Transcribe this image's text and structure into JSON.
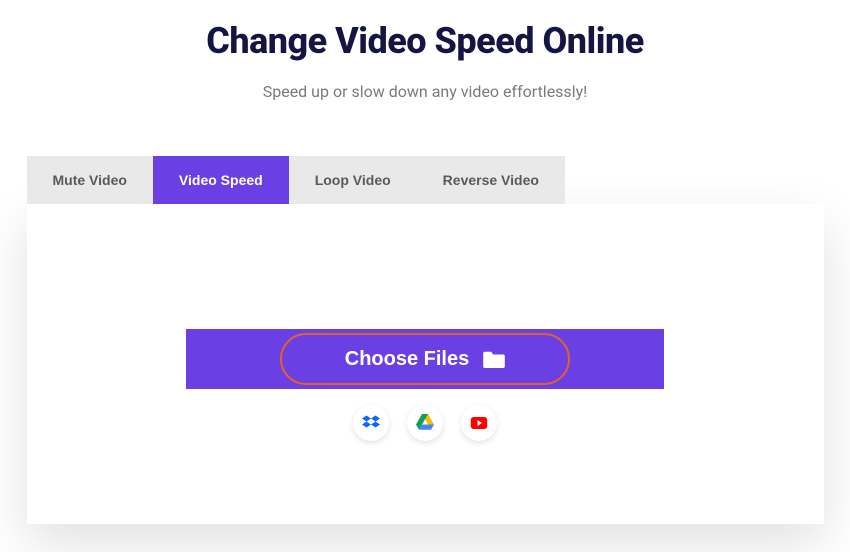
{
  "header": {
    "title": "Change Video Speed Online",
    "subtitle": "Speed up or slow down any video effortlessly!"
  },
  "tabs": {
    "mute": "Mute Video",
    "speed": "Video Speed",
    "loop": "Loop Video",
    "reverse": "Reverse Video"
  },
  "upload": {
    "choose_label": "Choose Files"
  },
  "sources": {
    "dropbox": "dropbox",
    "gdrive": "google-drive",
    "youtube": "youtube"
  }
}
